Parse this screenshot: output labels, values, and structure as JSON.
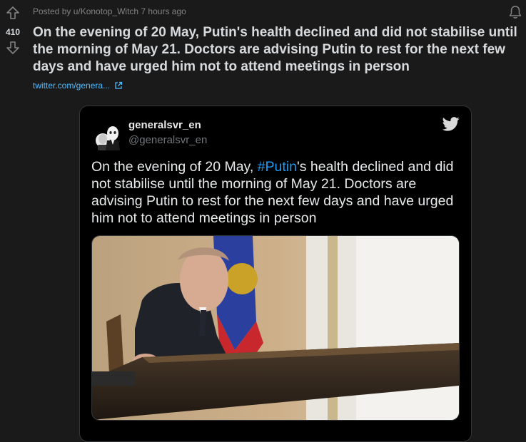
{
  "post": {
    "meta": "Posted by u/Konotop_Witch 7 hours ago",
    "score": "410",
    "title": "On the evening of 20 May, Putin's health declined and did not stabilise until the morning of May 21. Doctors are advising Putin to rest for the next few days and have urged him not to attend meetings in person",
    "link_label": "twitter.com/genera..."
  },
  "tweet": {
    "author_name": "generalsvr_en",
    "author_handle": "@generalsvr_en",
    "text_before": "On the evening of 20 May, ",
    "hashtag": "#Putin",
    "text_after": "'s health declined and did not stabilise until the morning of May 21. Doctors are advising Putin to rest for the next few days and have urged him not to attend meetings in person"
  },
  "icons": {
    "upvote": "upvote-arrow-icon",
    "downvote": "downvote-arrow-icon",
    "notification": "bell-icon",
    "external_link": "external-link-icon",
    "twitter": "twitter-bird-icon"
  },
  "colors": {
    "background": "#1a1a1b",
    "link": "#4fbcff",
    "hashtag": "#1d9bf0",
    "tweet_bg": "#000000"
  }
}
